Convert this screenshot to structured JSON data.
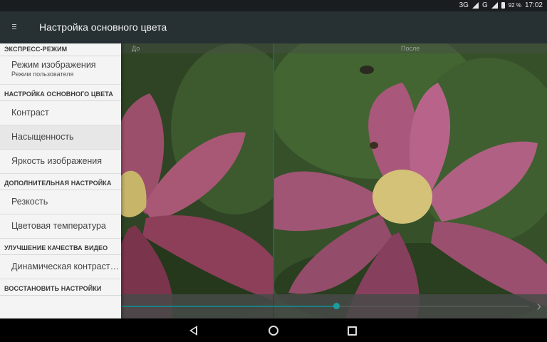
{
  "status_bar": {
    "network": "3G",
    "network2": "G",
    "battery_percent": "92 %",
    "time": "17:02"
  },
  "app_bar": {
    "title": "Настройка основного цвета",
    "menu_icon": "menu-icon"
  },
  "preview": {
    "before_label": "До",
    "after_label": "После",
    "slider_value_fraction": 0.62
  },
  "drawer": {
    "sections": [
      {
        "header": "ЭКСПРЕСС-РЕЖИМ",
        "items": [
          {
            "label": "Режим изображения",
            "sub": "Режим пользователя"
          }
        ]
      },
      {
        "header": "НАСТРОЙКА ОСНОВНОГО ЦВЕТА",
        "items": [
          {
            "label": "Контраст"
          },
          {
            "label": "Насыщенность",
            "selected": true
          },
          {
            "label": "Яркость изображения"
          }
        ]
      },
      {
        "header": "ДОПОЛНИТЕЛЬНАЯ НАСТРОЙКА",
        "items": [
          {
            "label": "Резкость"
          },
          {
            "label": "Цветовая температура"
          }
        ]
      },
      {
        "header": "УЛУЧШЕНИЕ КАЧЕСТВА ВИДЕО",
        "items": [
          {
            "label": "Динамическая контрастность"
          }
        ]
      },
      {
        "header": "ВОССТАНОВИТЬ НАСТРОЙКИ",
        "items": []
      }
    ]
  },
  "nav_bar": {
    "back": "back-icon",
    "home": "home-icon",
    "recents": "recents-icon"
  },
  "colors": {
    "accent": "#1d9da0",
    "app_bar": "#273134",
    "drawer_bg": "#f4f4f4"
  }
}
